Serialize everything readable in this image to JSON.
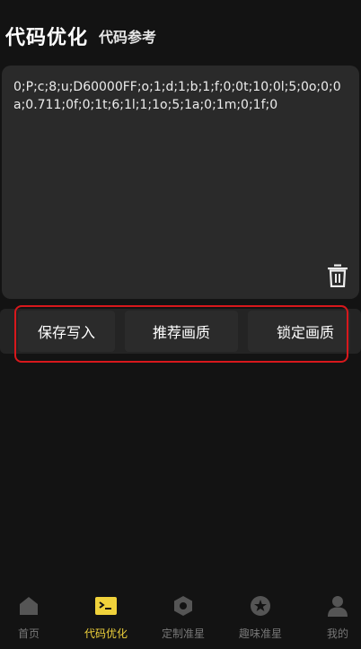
{
  "header": {
    "title": "代码优化",
    "subtitle": "代码参考"
  },
  "editor": {
    "code": "0;P;c;8;u;D60000FF;o;1;d;1;b;1;f;0;0t;10;0l;5;0o;0;0a;0.711;0f;0;1t;6;1l;1;1o;5;1a;0;1m;0;1f;0"
  },
  "actions": {
    "save_label": "保存写入",
    "recommend_label": "推荐画质",
    "lock_label": "锁定画质"
  },
  "nav": {
    "items": [
      {
        "label": "首页",
        "icon": "home-icon"
      },
      {
        "label": "代码优化",
        "icon": "terminal-icon",
        "active": true
      },
      {
        "label": "定制准星",
        "icon": "hexagon-icon"
      },
      {
        "label": "趣味准星",
        "icon": "star-icon"
      },
      {
        "label": "我的",
        "icon": "user-icon"
      }
    ],
    "active_color": "#f0d23b",
    "inactive_color": "#555555"
  },
  "colors": {
    "background": "#131313",
    "panel": "#2a2a2a",
    "highlight_border": "#d8181c"
  }
}
